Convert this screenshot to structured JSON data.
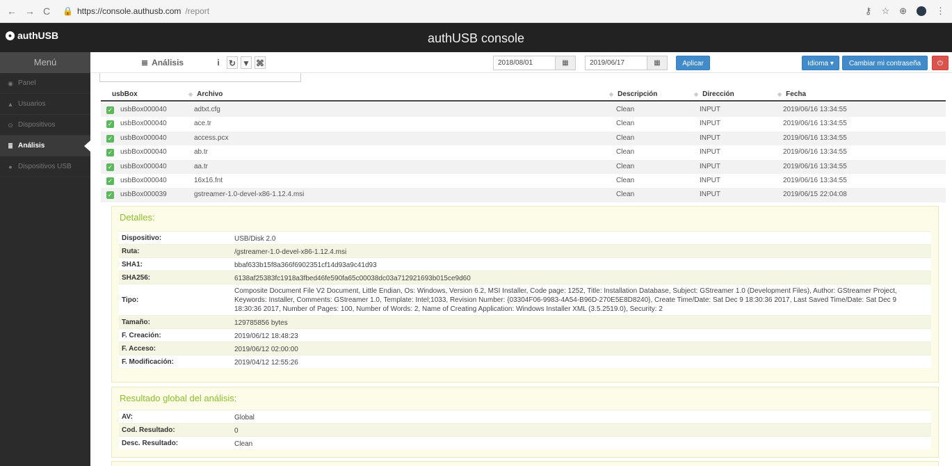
{
  "browser": {
    "url_host": "https://console.authusb.com",
    "url_path": "/report"
  },
  "header": {
    "brand": "authUSB",
    "title": "authUSB console"
  },
  "sidebar": {
    "menu_title": "Menú",
    "items": [
      {
        "label": "Panel",
        "icon": "dashboard-icon"
      },
      {
        "label": "Usuarios",
        "icon": "user-icon"
      },
      {
        "label": "Dispositivos",
        "icon": "device-icon"
      },
      {
        "label": "Análisis",
        "icon": "list-icon",
        "active": true
      },
      {
        "label": "Dispositivos USB",
        "icon": "usb-icon"
      }
    ]
  },
  "toolbar": {
    "section_title": "Análisis",
    "date_from": "2018/08/01",
    "date_to": "2019/06/17",
    "apply_label": "Aplicar",
    "language_label": "Idioma ▾",
    "change_password_label": "Cambiar mi contraseña",
    "info_glyph": "i",
    "refresh_glyph": "↻",
    "filter_glyph": "▼",
    "export_glyph": "⌘"
  },
  "table": {
    "columns": [
      "usbBox",
      "Archivo",
      "Descripción",
      "Dirección",
      "Fecha"
    ],
    "rows": [
      {
        "usbbox": "usbBox000040",
        "file": "adtxt.cfg",
        "desc": "Clean",
        "dir": "INPUT",
        "date": "2019/06/16 13:34:55"
      },
      {
        "usbbox": "usbBox000040",
        "file": "ace.tr",
        "desc": "Clean",
        "dir": "INPUT",
        "date": "2019/06/16 13:34:55"
      },
      {
        "usbbox": "usbBox000040",
        "file": "access.pcx",
        "desc": "Clean",
        "dir": "INPUT",
        "date": "2019/06/16 13:34:55"
      },
      {
        "usbbox": "usbBox000040",
        "file": "ab.tr",
        "desc": "Clean",
        "dir": "INPUT",
        "date": "2019/06/16 13:34:55"
      },
      {
        "usbbox": "usbBox000040",
        "file": "aa.tr",
        "desc": "Clean",
        "dir": "INPUT",
        "date": "2019/06/16 13:34:55"
      },
      {
        "usbbox": "usbBox000040",
        "file": "16x16.fnt",
        "desc": "Clean",
        "dir": "INPUT",
        "date": "2019/06/16 13:34:55"
      },
      {
        "usbbox": "usbBox000039",
        "file": "gstreamer-1.0-devel-x86-1.12.4.msi",
        "desc": "Clean",
        "dir": "INPUT",
        "date": "2019/06/15 22:04:08"
      }
    ]
  },
  "details": {
    "title": "Detalles:",
    "fields": [
      {
        "k": "Dispositivo:",
        "v": "USB/Disk 2.0"
      },
      {
        "k": "Ruta:",
        "v": "/gstreamer-1.0-devel-x86-1.12.4.msi"
      },
      {
        "k": "SHA1:",
        "v": "bbaf633b15f8a366f6902351cf14d93a9c41d93"
      },
      {
        "k": "SHA256:",
        "v": "6138af25383fc1918a3fbed46fe590fa65c00038dc03a712921693b015ce9d60"
      },
      {
        "k": "Tipo:",
        "v": "Composite Document File V2 Document, Little Endian, Os: Windows, Version 6.2, MSI Installer, Code page: 1252, Title: Installation Database, Subject: GStreamer 1.0 (Development Files), Author: GStreamer Project, Keywords: Installer, Comments: GStreamer 1.0, Template: Intel;1033, Revision Number: {03304F06-9983-4A54-B96D-270E5E8D8240}, Create Time/Date: Sat Dec 9 18:30:36 2017, Last Saved Time/Date: Sat Dec 9 18:30:36 2017, Number of Pages: 100, Number of Words: 2, Name of Creating Application: Windows Installer XML (3.5.2519.0), Security: 2"
      },
      {
        "k": "Tamaño:",
        "v": "129785856 bytes"
      },
      {
        "k": "F. Creación:",
        "v": "2019/06/12 18:48:23"
      },
      {
        "k": "F. Acceso:",
        "v": "2019/06/12 02:00:00"
      },
      {
        "k": "F. Modificación:",
        "v": "2019/04/12 12:55:26"
      }
    ]
  },
  "result": {
    "title": "Resultado global del análisis:",
    "fields": [
      {
        "k": "AV:",
        "v": "Global"
      },
      {
        "k": "Cod. Resultado:",
        "v": "0"
      },
      {
        "k": "Desc. Resultado:",
        "v": "Clean"
      }
    ]
  },
  "colors": {
    "accent": "#428bca",
    "danger": "#d9534f",
    "success": "#5cb85c",
    "panel_title": "#8cbf2b"
  }
}
